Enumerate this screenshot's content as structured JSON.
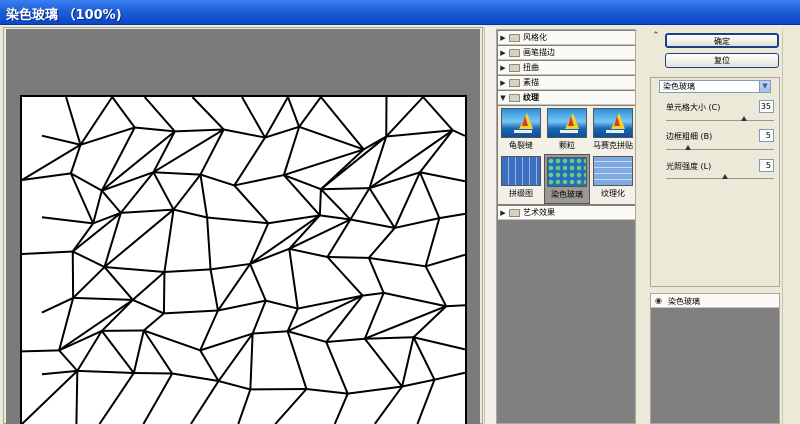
{
  "window": {
    "title": "染色玻璃 （100%)"
  },
  "gallery": {
    "categories": [
      {
        "label": "风格化",
        "open": false
      },
      {
        "label": "画笔描边",
        "open": false
      },
      {
        "label": "扭曲",
        "open": false
      },
      {
        "label": "素描",
        "open": false
      },
      {
        "label": "纹理",
        "open": true
      },
      {
        "label": "艺术效果",
        "open": false
      }
    ],
    "thumbs": [
      {
        "label": "龟裂缝",
        "icon": "sailboat-thumbnail"
      },
      {
        "label": "颗粒",
        "icon": "sailboat-thumbnail"
      },
      {
        "label": "马赛克拼贴",
        "icon": "sailboat-thumbnail"
      },
      {
        "label": "拼缀图",
        "icon": "tiles-thumbnail"
      },
      {
        "label": "染色玻璃",
        "icon": "stained-glass-thumbnail",
        "selected": true
      },
      {
        "label": "纹理化",
        "icon": "texture-thumbnail"
      }
    ]
  },
  "buttons": {
    "ok": "确定",
    "reset": "复位"
  },
  "settings": {
    "filter_select": "染色玻璃",
    "params": [
      {
        "label": "单元格大小 (C)",
        "value": "35",
        "level": 0.72
      },
      {
        "label": "边框粗细 (B)",
        "value": "5",
        "level": 0.2
      },
      {
        "label": "光照强度 (L)",
        "value": "5",
        "level": 0.55
      }
    ]
  },
  "effects": {
    "layer_label": "染色玻璃"
  },
  "colors": {
    "titlebar": "#1f5fd8",
    "preview_bg": "#7b7b7b"
  }
}
